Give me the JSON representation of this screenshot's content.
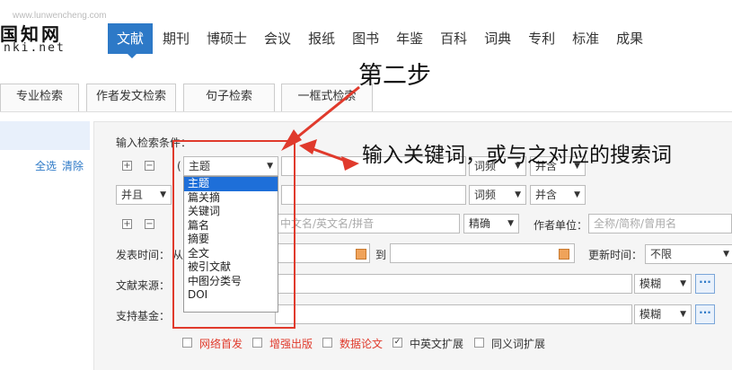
{
  "watermark": "www.lunwencheng.com",
  "logo": {
    "text": "国知网",
    "sub": "nki.net"
  },
  "nav": {
    "items": [
      "文献",
      "期刊",
      "博硕士",
      "会议",
      "报纸",
      "图书",
      "年鉴",
      "百科",
      "词典",
      "专利",
      "标准",
      "成果"
    ],
    "active_index": 0
  },
  "tabs": [
    "专业检索",
    "作者发文检索",
    "句子检索",
    "一框式检索"
  ],
  "form": {
    "title": "输入检索条件：",
    "select_all": "全选",
    "clear": "清除",
    "row1": {
      "paren": "(",
      "field": "主题",
      "freq": "词频",
      "match": "并含"
    },
    "row2": {
      "logic": "并且",
      "freq": "词频",
      "match": "并含"
    },
    "row3": {
      "author_placeholder": "中文名/英文名/拼音",
      "precision": "精确",
      "unit_label": "作者单位：",
      "unit_placeholder": "全称/简称/曾用名"
    },
    "date": {
      "label": "发表时间：",
      "from": "从",
      "to": "到",
      "update_label": "更新时间：",
      "update_value": "不限"
    },
    "source": {
      "label": "文献来源：",
      "mode": "模糊"
    },
    "fund": {
      "label": "支持基金：",
      "mode": "模糊"
    },
    "options": [
      {
        "label": "网络首发",
        "checked": false,
        "red": true
      },
      {
        "label": "增强出版",
        "checked": false,
        "red": true
      },
      {
        "label": "数据论文",
        "checked": false,
        "red": true
      },
      {
        "label": "中英文扩展",
        "checked": true,
        "red": false
      },
      {
        "label": "同义词扩展",
        "checked": false,
        "red": false
      }
    ]
  },
  "dropdown": {
    "options": [
      "主题",
      "篇关摘",
      "关键词",
      "篇名",
      "摘要",
      "全文",
      "被引文献",
      "中图分类号",
      "DOI"
    ],
    "selected_index": 0
  },
  "annotation": {
    "step": "第二步",
    "instruction": "输入关键词，或与之对应的搜索词"
  },
  "colors": {
    "accent": "#2d79c7",
    "highlight": "#e03a2c"
  }
}
